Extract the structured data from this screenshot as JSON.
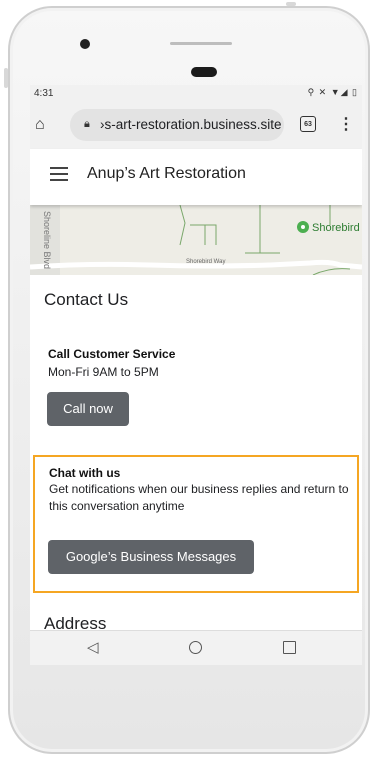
{
  "status_bar": {
    "time": "4:31",
    "icons": "⚲ ✕ ▼◢ ▯"
  },
  "browser": {
    "url": "›s-art-restoration.business.site",
    "tab_count": "63",
    "home_icon": "home-icon",
    "lock_icon": "lock-icon"
  },
  "site": {
    "title": "Anup’s Art Restoration"
  },
  "map": {
    "road_label_vertical": "Shoreline Blvd",
    "road_label_bottom": "Shorebird Way",
    "place_label": "Shorebird"
  },
  "contact": {
    "heading": "Contact Us",
    "service_title": "Call Customer Service",
    "service_hours": "Mon-Fri 9AM to 5PM",
    "call_button": "Call now"
  },
  "chat": {
    "title": "Chat with us",
    "description": "Get notifications when our business replies and return to this conversation anytime",
    "button": "Google’s Business Messages",
    "highlight_color": "#f5a623"
  },
  "address": {
    "heading": "Address"
  },
  "colors": {
    "button_bg": "#5f6368",
    "chrome_bg": "#f1f1f1"
  }
}
